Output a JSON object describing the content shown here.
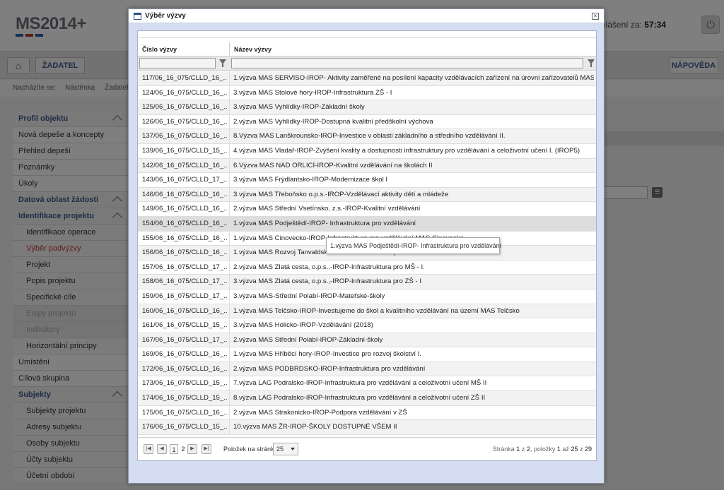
{
  "app": {
    "logo": "MS2014+",
    "logo_colors": [
      "#2e5ea8",
      "#c0392b",
      "#2e5ea8"
    ],
    "logout_label": "Odhlášení za:",
    "logout_time": "57:34",
    "nav": {
      "zadatel": "ŽADATEL",
      "help": "NÁPOVĚDA"
    },
    "breadcrumb": {
      "prefix": "Nacházíte se:",
      "items": [
        "Nástěnka",
        "Žadatel"
      ]
    },
    "sidebar": [
      {
        "label": "Profil objektu",
        "kind": "head",
        "chevron": true
      },
      {
        "label": "Nová depeše a koncepty",
        "kind": "item"
      },
      {
        "label": "Přehled depeší",
        "kind": "item"
      },
      {
        "label": "Poznámky",
        "kind": "item"
      },
      {
        "label": "Úkoly",
        "kind": "item"
      },
      {
        "label": "Datová oblast žádosti",
        "kind": "head",
        "chevron": true
      },
      {
        "label": "Identifikace projektu",
        "kind": "subhead",
        "chevron": true
      },
      {
        "label": "Identifikace operace",
        "kind": "sub"
      },
      {
        "label": "Výběr podvýzvy",
        "kind": "sub-active"
      },
      {
        "label": "Projekt",
        "kind": "sub"
      },
      {
        "label": "Popis projektu",
        "kind": "sub"
      },
      {
        "label": "Specifické cíle",
        "kind": "sub"
      },
      {
        "label": "Etapy projektu",
        "kind": "sub-disabled"
      },
      {
        "label": "Indikátory",
        "kind": "sub-disabled"
      },
      {
        "label": "Horizontální principy",
        "kind": "sub"
      },
      {
        "label": "Umístění",
        "kind": "item"
      },
      {
        "label": "Cílová skupina",
        "kind": "item"
      },
      {
        "label": "Subjekty",
        "kind": "subhead",
        "chevron": true
      },
      {
        "label": "Subjekty projektu",
        "kind": "sub"
      },
      {
        "label": "Adresy subjektu",
        "kind": "sub"
      },
      {
        "label": "Osoby subjektu",
        "kind": "sub"
      },
      {
        "label": "Účty subjektu",
        "kind": "sub"
      },
      {
        "label": "Účetní období",
        "kind": "sub"
      }
    ]
  },
  "modal": {
    "title": "Výběr výzvy",
    "columns": {
      "number": "Číslo výzvy",
      "name": "Název výzvy"
    },
    "rows": [
      {
        "number": "117/06_16_075/CLLD_16_...",
        "name": "1.výzva MAS SERVISO-IROP- Aktivity zaměřené na posílení kapacity vzdělávacích zařízení na úrovni zařízovatelů MAS SERVIS..."
      },
      {
        "number": "124/06_16_075/CLLD_16_...",
        "name": "3.výzva MAS Stolové hory-IROP-Infrastruktura ZŠ - I"
      },
      {
        "number": "125/06_16_075/CLLD_16_...",
        "name": "3.výzva MAS Vyhlídky-IROP-Základní školy"
      },
      {
        "number": "126/06_16_075/CLLD_16_...",
        "name": "2.výzva MAS Vyhlídky-IROP-Dostupná kvalitní předškolní výchova"
      },
      {
        "number": "137/06_16_075/CLLD_16_...",
        "name": "8.Výzva MAS Lanškrounsko-IROP-Investice v oblasti základního a středního vzdělávání II."
      },
      {
        "number": "139/06_16_075/CLLD_15_...",
        "name": "4.výzva MAS Vladař-IROP-Zvýšení kvality a dostupnosti infrastruktury pro vzdělávání a celoživotní učení I. (IROP5)"
      },
      {
        "number": "142/06_16_075/CLLD_16_...",
        "name": "6.Výzva MAS NAD ORLICÍ-IROP-Kvalitní vzdělávání na školách II"
      },
      {
        "number": "143/06_16_075/CLLD_17_...",
        "name": "3.výzva MAS Frýdlantsko-IROP-Modernizace škol I"
      },
      {
        "number": "146/06_16_075/CLLD_16_...",
        "name": "3.výzva MAS Třeboňsko o.p.s.-IROP-Vzdělávací aktivity dětí a mládeže"
      },
      {
        "number": "149/06_16_075/CLLD_16_...",
        "name": "2.výzva MAS Střední Vsetínsko, z.s.-IROP-Kvalitní vzdělávání"
      },
      {
        "number": "154/06_16_075/CLLD_16_...",
        "name": "1.výzva MAS Podještědí-IROP- Infrastruktura pro vzdělávání"
      },
      {
        "number": "155/06_16_075/CLLD_16_...",
        "name": "1.výzva MAS Cinovecko-IROP-Infrastruktura pro vzdělávání MAS Cinovecko"
      },
      {
        "number": "156/06_16_075/CLLD_16_...",
        "name": "1.výzva MAS Rozvoj Tanvaldska-IROP-Infrastruktura pro vzdělávání"
      },
      {
        "number": "157/06_16_075/CLLD_17_...",
        "name": "2.výzva MAS Zlatá cesta, o.p.s.,-IROP-Infrastruktura pro MŠ - I."
      },
      {
        "number": "158/06_16_075/CLLD_17_...",
        "name": "3.výzva MAS Zlatá cesta, o.p.s.,-IROP-Infrastruktura pro ZŠ - I"
      },
      {
        "number": "159/06_16_075/CLLD_17_...",
        "name": "3.výzva MAS-Střední Polabí-IROP-Mateřské-školy"
      },
      {
        "number": "160/06_16_075/CLLD_16_...",
        "name": "1.výzva MAS Telčsko-IROP-Investujeme do škol a kvalitního vzdělávání na území MAS Telčsko"
      },
      {
        "number": "161/06_16_075/CLLD_15_...",
        "name": "3.výzva MAS Holicko-IROP-Vzdělávání (2018)"
      },
      {
        "number": "167/06_16_075/CLLD_17_...",
        "name": "2.výzva MAS Střední Polabí-IROP-Základní-školy"
      },
      {
        "number": "169/06_16_075/CLLD_16_...",
        "name": "1.výzva MAS Hříběcí hory-IROP-Investice pro rozvoj školství I."
      },
      {
        "number": "172/06_16_075/CLLD_16_...",
        "name": "2.výzva MAS PODBRDSKO-IROP-Infrastruktura pro vzdělávání"
      },
      {
        "number": "173/06_16_075/CLLD_15_...",
        "name": "7.výzva LAG Podralsko-IROP-Infrastruktura pro vzdělávání a celoživotní učení MŠ II"
      },
      {
        "number": "174/06_16_075/CLLD_15_...",
        "name": "8.výzva LAG Podralsko-IROP-Infrastruktura pro vzdělávání a celoživotní učení ZŠ II"
      },
      {
        "number": "175/06_16_075/CLLD_16_...",
        "name": "2.výzva MAS Strakonicko-IROP-Podpora vzdělávání v ZŠ"
      },
      {
        "number": "176/06_16_075/CLLD_15_...",
        "name": "10.výzva MAS ŽR-IROP-ŠKOLY DOSTUPNÉ VŠEM II"
      }
    ],
    "hover_row_index": 10,
    "tooltip": "1.výzva MAS Podještědí-IROP- Infrastruktura pro vzdělávání",
    "pager": {
      "first_icon": "first-page-icon",
      "prev_icon": "prev-page-icon",
      "next_icon": "next-page-icon",
      "last_icon": "last-page-icon",
      "page1": "1",
      "page2": "2",
      "per_page_label": "Položek na stránku",
      "per_page_value": "25",
      "info_prefix": "Stránka",
      "page": "1",
      "of1": "z",
      "pages": "2",
      "items_label": ", položky",
      "from": "1",
      "to_label": "až",
      "to": "25",
      "of2": "z",
      "total": "29"
    }
  }
}
